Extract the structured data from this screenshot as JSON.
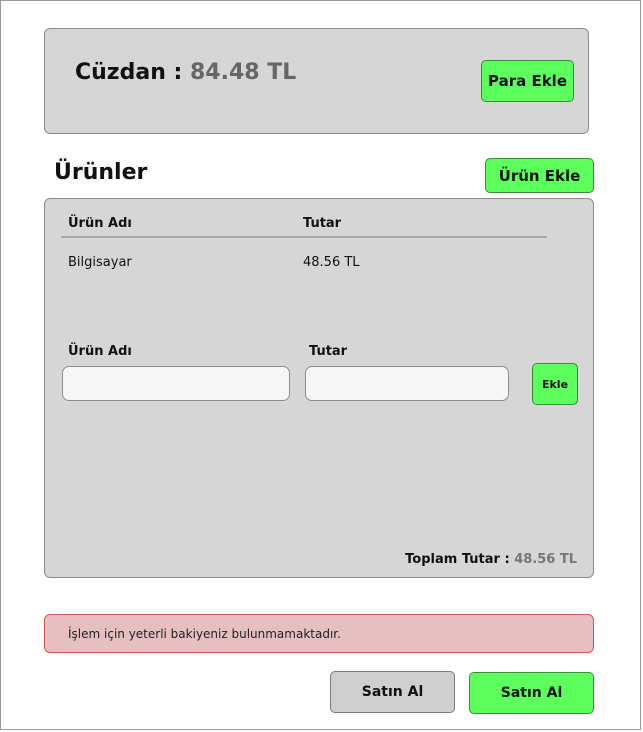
{
  "wallet": {
    "label": "Cüzdan :",
    "balance": "84.48 TL",
    "add_money_label": "Para Ekle"
  },
  "products": {
    "heading": "Ürünler",
    "add_product_label": "Ürün Ekle",
    "columns": [
      "Ürün Adı",
      "Tutar"
    ],
    "rows": [
      {
        "name": "Bilgisayar",
        "amount": "48.56 TL"
      }
    ],
    "form": {
      "name_label": "Ürün Adı",
      "amount_label": "Tutar",
      "name_value": "",
      "amount_value": "",
      "add_label": "Ekle"
    },
    "total_label": "Toplam Tutar :",
    "total_value": "48.56 TL"
  },
  "alert": {
    "message": "İşlem için yeterli bakiyeniz bulunmamaktadır."
  },
  "actions": {
    "secondary_buy_label": "Satın Al",
    "primary_buy_label": "Satın Al"
  },
  "colors": {
    "accent_green": "#5cff5c",
    "panel_grey": "#d6d6d6",
    "alert_bg": "#e6c0c0",
    "alert_border": "#c95a5a"
  }
}
